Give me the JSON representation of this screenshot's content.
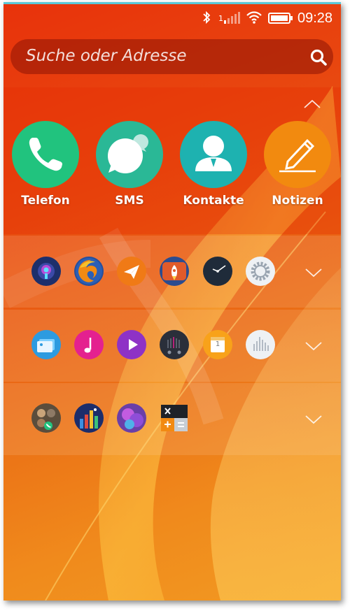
{
  "status": {
    "time": "09:28",
    "signal_label": "1",
    "icons": [
      "bluetooth-icon",
      "signal-icon",
      "wifi-icon",
      "battery-icon"
    ]
  },
  "search": {
    "placeholder": "Suche oder Adresse",
    "icon": "search-icon"
  },
  "favorites": [
    {
      "label": "Telefon",
      "icon": "phone-icon",
      "color": "#21c37e"
    },
    {
      "label": "SMS",
      "icon": "chat-bubbles-icon",
      "color": "#2ab896"
    },
    {
      "label": "Kontakte",
      "icon": "person-icon",
      "color": "#1eb2b0"
    },
    {
      "label": "Notizen",
      "icon": "pencil-icon",
      "color": "#f28a0f"
    }
  ],
  "groups": [
    {
      "apps": [
        "podcast-app-icon",
        "firefox-icon",
        "paper-plane-icon",
        "rocket-app-icon",
        "clock-icon",
        "settings-icon"
      ]
    },
    {
      "apps": [
        "gallery-icon",
        "music-icon",
        "video-icon",
        "fm-radio-icon",
        "calendar-icon",
        "equalizer-icon"
      ]
    },
    {
      "apps": [
        "contacts-photo-app-icon",
        "city-game-icon",
        "purple-game-icon",
        "calculator-icon"
      ]
    }
  ],
  "calendar": {
    "day": "1"
  },
  "colors": {
    "accent_top": "#5bc7d6",
    "background_start": "#e8320b",
    "background_end": "#f29a22"
  }
}
